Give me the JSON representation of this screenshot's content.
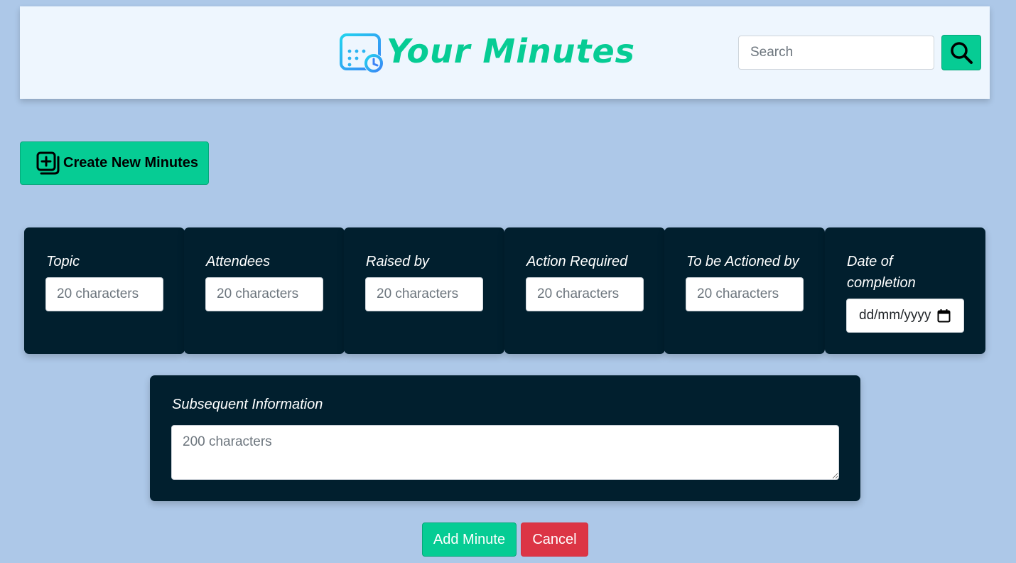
{
  "header": {
    "title": "Your Minutes",
    "logo_icon": "calendar-clock-icon",
    "search": {
      "placeholder": "Search",
      "value": ""
    },
    "search_icon": "search-icon"
  },
  "create_button": {
    "label": "Create New Minutes",
    "icon": "add-copy-icon"
  },
  "form": {
    "fields": [
      {
        "label": "Topic",
        "placeholder": "20 characters"
      },
      {
        "label": "Attendees",
        "placeholder": "20 characters"
      },
      {
        "label": "Raised by",
        "placeholder": "20 characters"
      },
      {
        "label": "Action Required",
        "placeholder": "20 characters"
      },
      {
        "label": "To be Actioned by",
        "placeholder": "20 characters"
      }
    ],
    "date_field": {
      "label": "Date of completion",
      "placeholder": "dd/mm/yyyy",
      "icon": "calendar-icon"
    },
    "subsequent": {
      "label": "Subsequent Information",
      "placeholder": "200 characters"
    }
  },
  "actions": {
    "add_label": "Add Minute",
    "cancel_label": "Cancel"
  },
  "colors": {
    "background": "#adc8e8",
    "accent": "#06cc94",
    "card": "#011f2e",
    "danger": "#dc3545"
  }
}
